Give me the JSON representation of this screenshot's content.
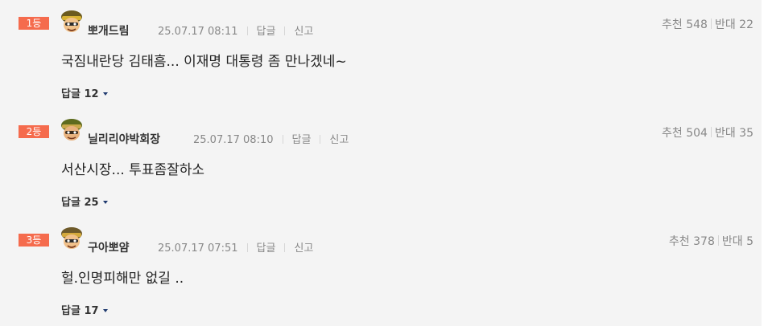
{
  "comments": [
    {
      "rank": "1등",
      "nickname": "뽀개드림",
      "date": "25.07.17 08:11",
      "reply_link": "답글",
      "report_link": "신고",
      "like_label": "추천",
      "like_count": "548",
      "dislike_label": "반대",
      "dislike_count": "22",
      "content": "국짐내란당 김태흠... 이재명 대통령 좀 만나겠네~",
      "replies_label": "답글",
      "replies_count": "12"
    },
    {
      "rank": "2등",
      "nickname": "닐리리야박회장",
      "date": "25.07.17 08:10",
      "reply_link": "답글",
      "report_link": "신고",
      "like_label": "추천",
      "like_count": "504",
      "dislike_label": "반대",
      "dislike_count": "35",
      "content": "서산시장... 투표좀잘하소",
      "replies_label": "답글",
      "replies_count": "25"
    },
    {
      "rank": "3등",
      "nickname": "구아뽀얌",
      "date": "25.07.17 07:51",
      "reply_link": "답글",
      "report_link": "신고",
      "like_label": "추천",
      "like_count": "378",
      "dislike_label": "반대",
      "dislike_count": "5",
      "content": "헐.인명피해만 없길 ..",
      "replies_label": "답글",
      "replies_count": "17"
    }
  ],
  "colors": {
    "rank_badge": "#f56b4d",
    "panel_background": "#f4f4f4",
    "caret": "#1f3a6f"
  },
  "icons": {
    "avatar": "soldier-avatar-icon",
    "replies_toggle": "caret-down-icon"
  }
}
